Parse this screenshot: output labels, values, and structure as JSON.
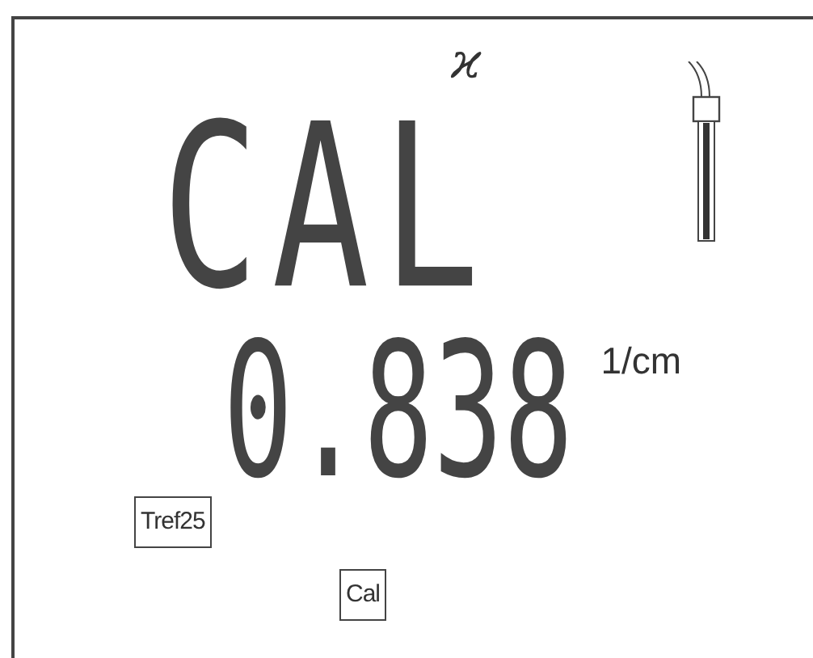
{
  "mode_symbol": "ϰ",
  "main_display": "CAL",
  "reading": {
    "value": "0.838",
    "unit": "1/cm"
  },
  "temperature_reference": "Tref25",
  "status_indicator": "Cal"
}
